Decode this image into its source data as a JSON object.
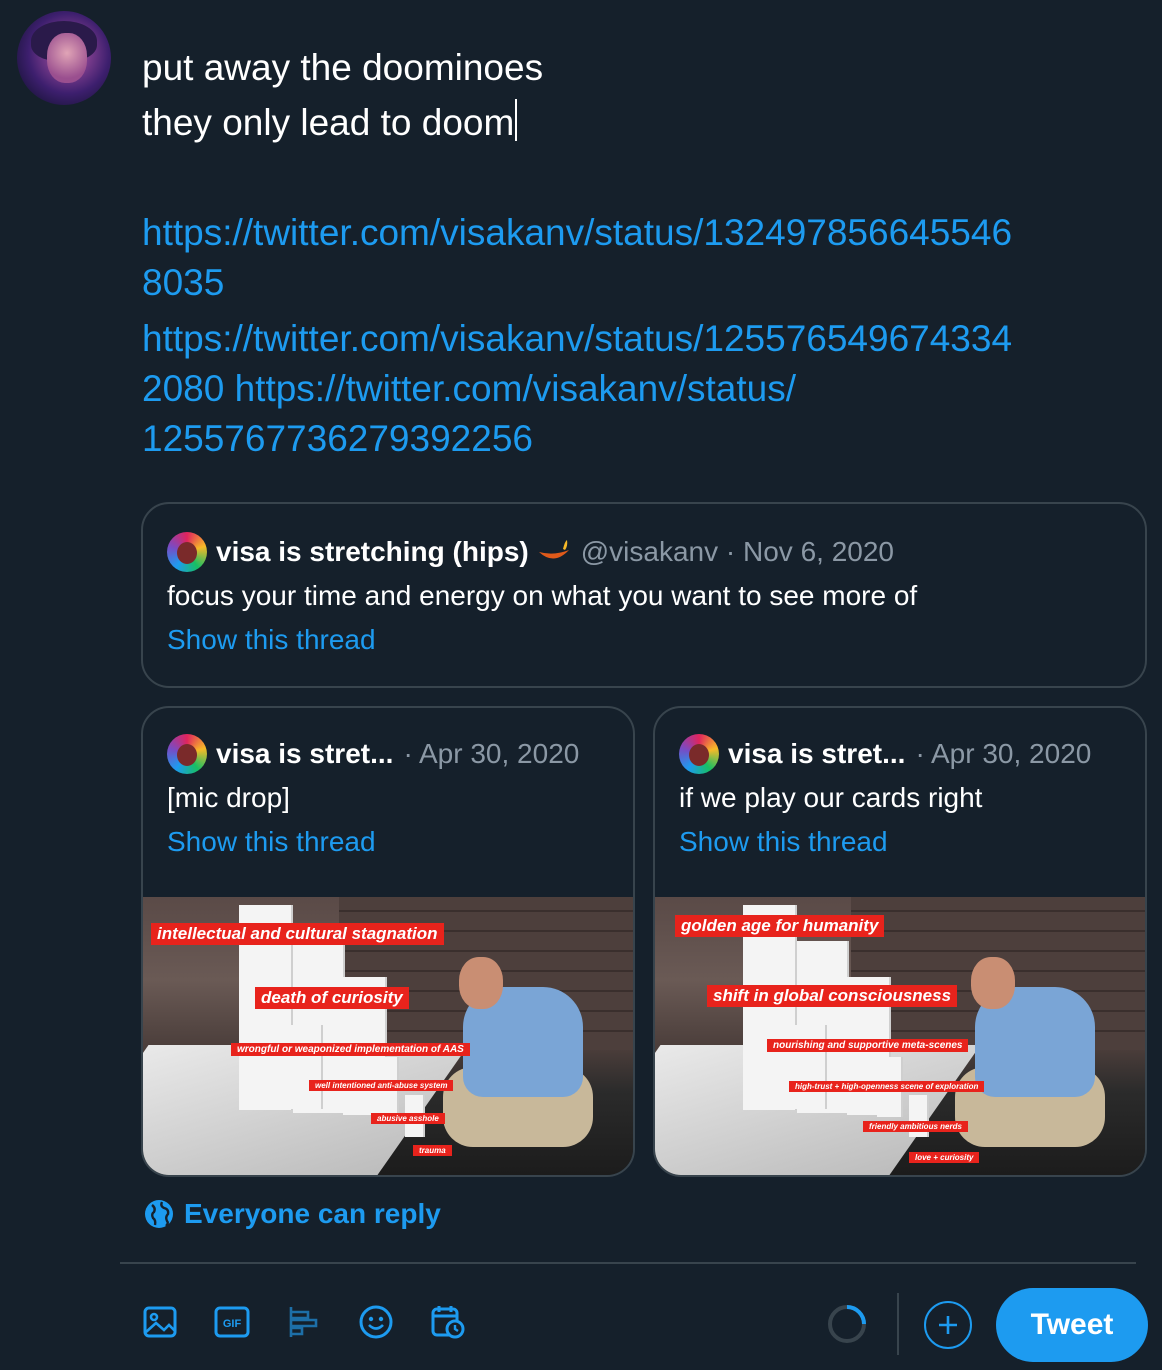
{
  "compose": {
    "line1": "put away the doominoes",
    "line2": "they only lead to doom"
  },
  "links": {
    "l1a": "https://twitter.com/visakanv/status/132497856645546",
    "l1b": "8035",
    "l2a": "https://twitter.com/visakanv/status/125576549674334",
    "l2b": "2080 https://twitter.com/visakanv/status/",
    "l3": "1255767736279392256"
  },
  "quote_main": {
    "name": "visa is stretching (hips)",
    "meta": "@visakanv · Nov 6, 2020",
    "text": "focus your time and energy on what you want to see more of",
    "show": "Show this thread"
  },
  "quote_left": {
    "name": "visa is stret...",
    "meta": "· Apr 30, 2020",
    "text": "[mic drop]",
    "show": "Show this thread",
    "labels": [
      "intellectual and cultural stagnation",
      "death of curiosity",
      "wrongful or weaponized implementation of AAS",
      "well intentioned anti-abuse system",
      "abusive asshole",
      "trauma"
    ]
  },
  "quote_right": {
    "name": "visa is stret...",
    "meta": "· Apr 30, 2020",
    "text": "if we play our cards right",
    "show": "Show this thread",
    "labels": [
      "golden age for humanity",
      "shift in global consciousness",
      "nourishing and supportive meta-scenes",
      "high-trust + high-openness scene of exploration",
      "friendly ambitious nerds",
      "love + curiosity"
    ]
  },
  "reply_setting": "Everyone can reply",
  "toolbar": {
    "icons": [
      "image-icon",
      "gif-icon",
      "poll-icon",
      "emoji-icon",
      "schedule-icon"
    ],
    "gif_label": "GIF"
  },
  "tweet_button": "Tweet",
  "colors": {
    "background": "#15202b",
    "accent": "#1d9bf0",
    "border": "#38444d",
    "muted": "#8b98a5",
    "meme_label": "#e8231c"
  }
}
